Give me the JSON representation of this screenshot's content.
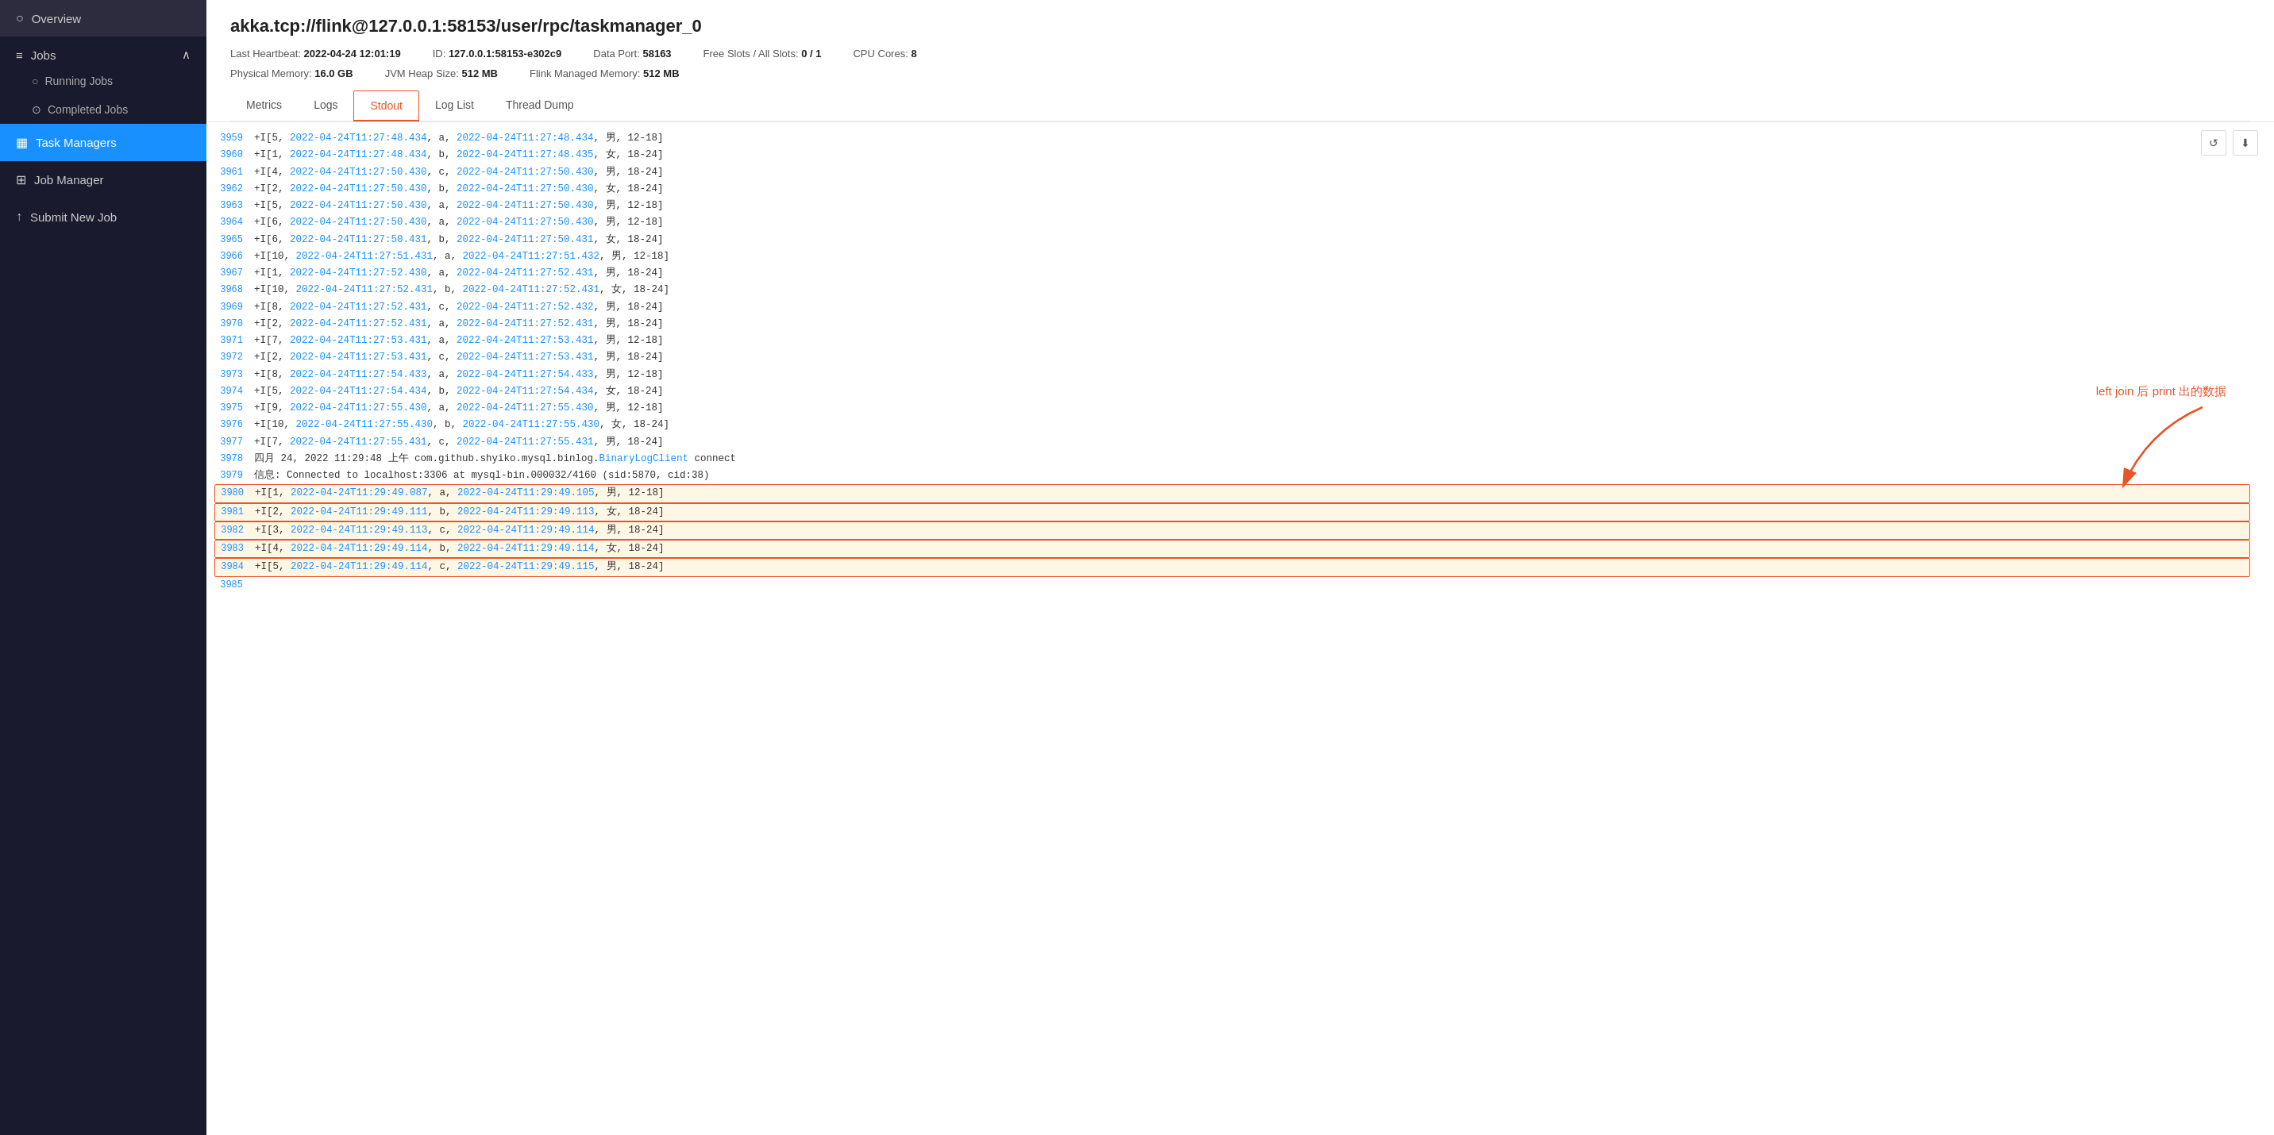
{
  "sidebar": {
    "items": [
      {
        "id": "overview",
        "label": "Overview",
        "icon": "○",
        "active": false
      },
      {
        "id": "jobs",
        "label": "Jobs",
        "icon": "≡",
        "active": false,
        "expanded": true
      },
      {
        "id": "running-jobs",
        "label": "Running Jobs",
        "icon": "○",
        "active": false,
        "sub": true
      },
      {
        "id": "completed-jobs",
        "label": "Completed Jobs",
        "icon": "⊙",
        "active": false,
        "sub": true
      },
      {
        "id": "task-managers",
        "label": "Task Managers",
        "icon": "▦",
        "active": true
      },
      {
        "id": "job-manager",
        "label": "Job Manager",
        "icon": "⊞",
        "active": false
      },
      {
        "id": "submit-new-job",
        "label": "Submit New Job",
        "icon": "↑",
        "active": false
      }
    ]
  },
  "header": {
    "title": "akka.tcp://flink@127.0.0.1:58153/user/rpc/taskmanager_0",
    "meta_row1": [
      {
        "label": "Last Heartbeat:",
        "value": "2022-04-24 12:01:19"
      },
      {
        "label": "ID:",
        "value": "127.0.0.1:58153-e302c9"
      },
      {
        "label": "Data Port:",
        "value": "58163"
      },
      {
        "label": "Free Slots / All Slots:",
        "value": "0 / 1"
      },
      {
        "label": "CPU Cores:",
        "value": "8"
      }
    ],
    "meta_row2": [
      {
        "label": "Physical Memory:",
        "value": "16.0 GB"
      },
      {
        "label": "JVM Heap Size:",
        "value": "512 MB"
      },
      {
        "label": "Flink Managed Memory:",
        "value": "512 MB"
      }
    ]
  },
  "tabs": [
    {
      "id": "metrics",
      "label": "Metrics",
      "active": false
    },
    {
      "id": "logs",
      "label": "Logs",
      "active": false
    },
    {
      "id": "stdout",
      "label": "Stdout",
      "active": true
    },
    {
      "id": "log-list",
      "label": "Log List",
      "active": false
    },
    {
      "id": "thread-dump",
      "label": "Thread Dump",
      "active": false
    }
  ],
  "log_lines": [
    {
      "num": "3959",
      "text": "+I[5, 2022-04-24T11:27:48.434, a, 2022-04-24T11:27:48.434, 男, 12-18]",
      "highlight": false
    },
    {
      "num": "3960",
      "text": "+I[1, 2022-04-24T11:27:48.434, b, 2022-04-24T11:27:48.435, 女, 18-24]",
      "highlight": false
    },
    {
      "num": "3961",
      "text": "+I[4, 2022-04-24T11:27:50.430, c, 2022-04-24T11:27:50.430, 男, 18-24]",
      "highlight": false
    },
    {
      "num": "3962",
      "text": "+I[2, 2022-04-24T11:27:50.430, b, 2022-04-24T11:27:50.430, 女, 18-24]",
      "highlight": false
    },
    {
      "num": "3963",
      "text": "+I[5, 2022-04-24T11:27:50.430, a, 2022-04-24T11:27:50.430, 男, 12-18]",
      "highlight": false
    },
    {
      "num": "3964",
      "text": "+I[6, 2022-04-24T11:27:50.430, a, 2022-04-24T11:27:50.430, 男, 12-18]",
      "highlight": false
    },
    {
      "num": "3965",
      "text": "+I[6, 2022-04-24T11:27:50.431, b, 2022-04-24T11:27:50.431, 女, 18-24]",
      "highlight": false
    },
    {
      "num": "3966",
      "text": "+I[10, 2022-04-24T11:27:51.431, a, 2022-04-24T11:27:51.432, 男, 12-18]",
      "highlight": false
    },
    {
      "num": "3967",
      "text": "+I[1, 2022-04-24T11:27:52.430, a, 2022-04-24T11:27:52.431, 男, 18-24]",
      "highlight": false
    },
    {
      "num": "3968",
      "text": "+I[10, 2022-04-24T11:27:52.431, b, 2022-04-24T11:27:52.431, 女, 18-24]",
      "highlight": false
    },
    {
      "num": "3969",
      "text": "+I[8, 2022-04-24T11:27:52.431, c, 2022-04-24T11:27:52.432, 男, 18-24]",
      "highlight": false
    },
    {
      "num": "3970",
      "text": "+I[2, 2022-04-24T11:27:52.431, a, 2022-04-24T11:27:52.431, 男, 18-24]",
      "highlight": false
    },
    {
      "num": "3971",
      "text": "+I[7, 2022-04-24T11:27:53.431, a, 2022-04-24T11:27:53.431, 男, 12-18]",
      "highlight": false
    },
    {
      "num": "3972",
      "text": "+I[2, 2022-04-24T11:27:53.431, c, 2022-04-24T11:27:53.431, 男, 18-24]",
      "highlight": false
    },
    {
      "num": "3973",
      "text": "+I[8, 2022-04-24T11:27:54.433, a, 2022-04-24T11:27:54.433, 男, 12-18]",
      "highlight": false
    },
    {
      "num": "3974",
      "text": "+I[5, 2022-04-24T11:27:54.434, b, 2022-04-24T11:27:54.434, 女, 18-24]",
      "highlight": false
    },
    {
      "num": "3975",
      "text": "+I[9, 2022-04-24T11:27:55.430, a, 2022-04-24T11:27:55.430, 男, 12-18]",
      "highlight": false
    },
    {
      "num": "3976",
      "text": "+I[10, 2022-04-24T11:27:55.430, b, 2022-04-24T11:27:55.430, 女, 18-24]",
      "highlight": false
    },
    {
      "num": "3977",
      "text": "+I[7, 2022-04-24T11:27:55.431, c, 2022-04-24T11:27:55.431, 男, 18-24]",
      "highlight": false
    },
    {
      "num": "3978",
      "text": "四月 24, 2022 11:29:48 上午 com.github.shyiko.mysql.binlog.BinaryLogClient connect",
      "highlight": false,
      "special": true
    },
    {
      "num": "3979",
      "text": "信息: Connected to localhost:3306 at mysql-bin.000032/4160 (sid:5870, cid:38)",
      "highlight": false,
      "special2": true
    },
    {
      "num": "3980",
      "text": "+I[1, 2022-04-24T11:29:49.087, a, 2022-04-24T11:29:49.105, 男, 12-18]",
      "highlight": true
    },
    {
      "num": "3981",
      "text": "+I[2, 2022-04-24T11:29:49.111, b, 2022-04-24T11:29:49.113, 女, 18-24]",
      "highlight": true
    },
    {
      "num": "3982",
      "text": "+I[3, 2022-04-24T11:29:49.113, c, 2022-04-24T11:29:49.114, 男, 18-24]",
      "highlight": true
    },
    {
      "num": "3983",
      "text": "+I[4, 2022-04-24T11:29:49.114, b, 2022-04-24T11:29:49.114, 女, 18-24]",
      "highlight": true
    },
    {
      "num": "3984",
      "text": "+I[5, 2022-04-24T11:29:49.114, c, 2022-04-24T11:29:49.115, 男, 18-24]",
      "highlight": true
    },
    {
      "num": "3985",
      "text": "",
      "highlight": false
    }
  ],
  "annotation": {
    "text": "left join 后 print 出的数据"
  },
  "toolbar": {
    "refresh_label": "↺",
    "download_label": "⬇"
  }
}
